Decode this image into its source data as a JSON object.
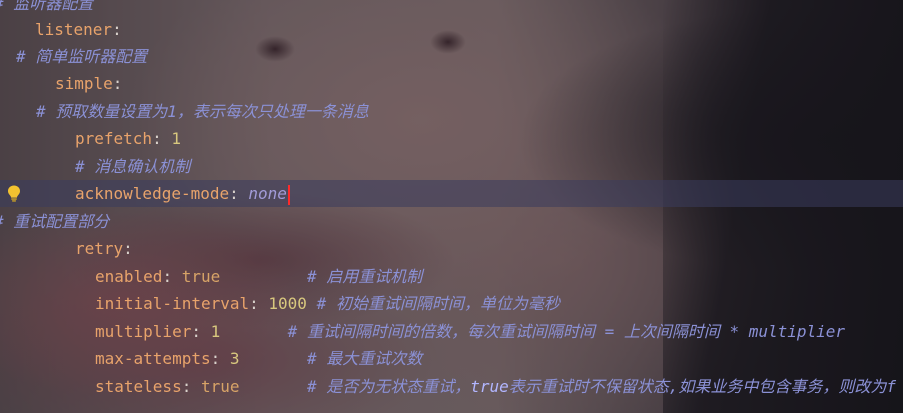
{
  "editor": {
    "lines": [
      {
        "type": "comment",
        "indent": 0,
        "text": "# 监听器配置"
      },
      {
        "type": "key",
        "indent": 1,
        "key": "listener",
        "sep": ":"
      },
      {
        "type": "comment",
        "indent": 1,
        "text": "# 简单监听器配置"
      },
      {
        "type": "key",
        "indent": 2,
        "key": "simple",
        "sep": ":"
      },
      {
        "type": "comment",
        "indent": 2,
        "text": "# 预取数量设置为1，表示每次只处理一条消息"
      },
      {
        "type": "keyval",
        "indent": 3,
        "key": "prefetch",
        "sep": ": ",
        "value": "1"
      },
      {
        "type": "comment",
        "indent": 3,
        "text": "# 消息确认机制"
      },
      {
        "type": "keyval",
        "indent": 3,
        "key": "acknowledge-mode",
        "sep": ": ",
        "value": "none",
        "current": true
      },
      {
        "type": "comment",
        "indent": 0,
        "text": "# 重试配置部分"
      },
      {
        "type": "key",
        "indent": 3,
        "key": "retry",
        "sep": ":"
      },
      {
        "type": "keyval_comment",
        "indent": 4,
        "key": "enabled",
        "sep": ": ",
        "value": "true",
        "pad": "         ",
        "comment": "# 启用重试机制"
      },
      {
        "type": "keyval_comment",
        "indent": 4,
        "key": "initial-interval",
        "sep": ": ",
        "value": "1000",
        "pad": " ",
        "comment": "# 初始重试间隔时间，单位为毫秒"
      },
      {
        "type": "keyval_comment",
        "indent": 4,
        "key": "multiplier",
        "sep": ": ",
        "value": "1",
        "pad": "       ",
        "comment": "# 重试间隔时间的倍数，每次重试间隔时间 = 上次间隔时间 * multiplier"
      },
      {
        "type": "keyval_comment",
        "indent": 4,
        "key": "max-attempts",
        "sep": ": ",
        "value": "3",
        "pad": "       ",
        "comment": "# 最大重试次数"
      },
      {
        "type": "keyval_comment",
        "indent": 4,
        "key": "stateless",
        "sep": ": ",
        "value": "true",
        "pad": "       ",
        "comment_parts": [
          "# 是否为无状态重试，",
          "true",
          "表示重试时不保留状态,如果业务中包含事务，则改为f"
        ]
      }
    ],
    "colors": {
      "key": "#e8a36b",
      "number": "#d8c87e",
      "comment": "#8b91d6",
      "enum_value": "#a29bd8",
      "caret": "#ff2a2a",
      "current_line": "#3a3d5c",
      "bulb": "#f2c230"
    },
    "gutter_icon": "lightbulb-icon"
  }
}
